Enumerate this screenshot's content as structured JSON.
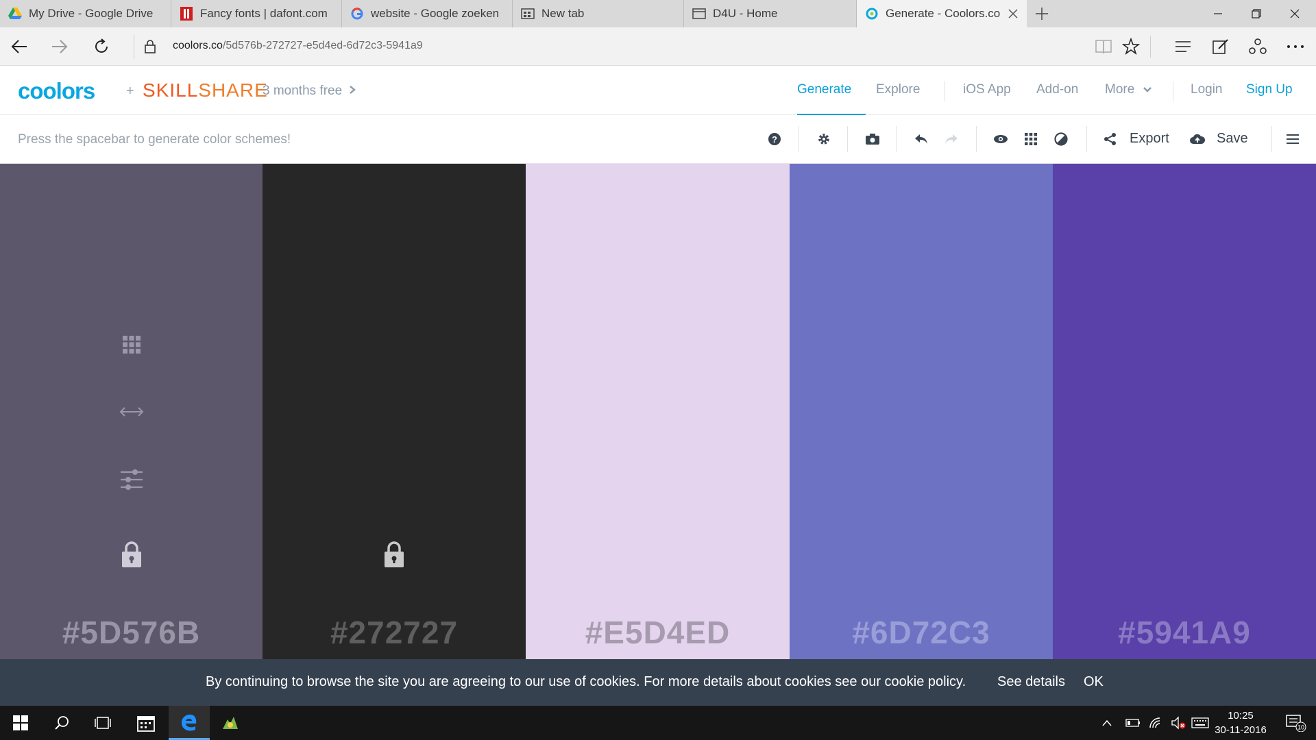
{
  "browser": {
    "tabs": [
      {
        "title": "My Drive - Google Drive",
        "icon": "google-drive-icon"
      },
      {
        "title": "Fancy fonts | dafont.com",
        "icon": "dafont-icon"
      },
      {
        "title": "website - Google zoeken",
        "icon": "google-icon"
      },
      {
        "title": "New tab",
        "icon": "new-tab-icon"
      },
      {
        "title": "D4U - Home",
        "icon": "page-icon"
      },
      {
        "title": "Generate - Coolors.co",
        "icon": "coolors-icon",
        "active": true
      }
    ],
    "url_host": "coolors.co",
    "url_path": "/5d576b-272727-e5d4ed-6d72c3-5941a9"
  },
  "site": {
    "logo": "coolors",
    "plus": "+",
    "partner_a": "SKILL",
    "partner_b": "SHARE",
    "promo": "3 months free",
    "nav": {
      "generate": "Generate",
      "explore": "Explore",
      "ios_app": "iOS App",
      "addon": "Add-on",
      "more": "More",
      "login": "Login",
      "signup": "Sign Up"
    }
  },
  "toolbar": {
    "hint": "Press the spacebar to generate color schemes!",
    "export": "Export",
    "save": "Save"
  },
  "palette": {
    "colors": [
      {
        "hex": "#5D576B",
        "bg": "#5d576b",
        "text_color": "#9994a6",
        "locked_icon": true,
        "tools_visible": true
      },
      {
        "hex": "#272727",
        "bg": "#272727",
        "text_color": "#5e5e5e",
        "locked_icon": true,
        "tools_visible": false
      },
      {
        "hex": "#E5D4ED",
        "bg": "#e5d4ed",
        "text_color": "#a79bb0",
        "locked_icon": false,
        "tools_visible": false
      },
      {
        "hex": "#6D72C3",
        "bg": "#6d72c3",
        "text_color": "#9a9ed8",
        "locked_icon": false,
        "tools_visible": false
      },
      {
        "hex": "#5941A9",
        "bg": "#5941a9",
        "text_color": "#8a79c4",
        "locked_icon": false,
        "tools_visible": false
      }
    ]
  },
  "cookie": {
    "message": "By continuing to browse the site you are agreeing to our use of cookies. For more details about cookies see our cookie policy.",
    "see_details": "See details",
    "ok": "OK"
  },
  "taskbar": {
    "time": "10:25",
    "date": "30-11-2016",
    "notifications": "10"
  }
}
